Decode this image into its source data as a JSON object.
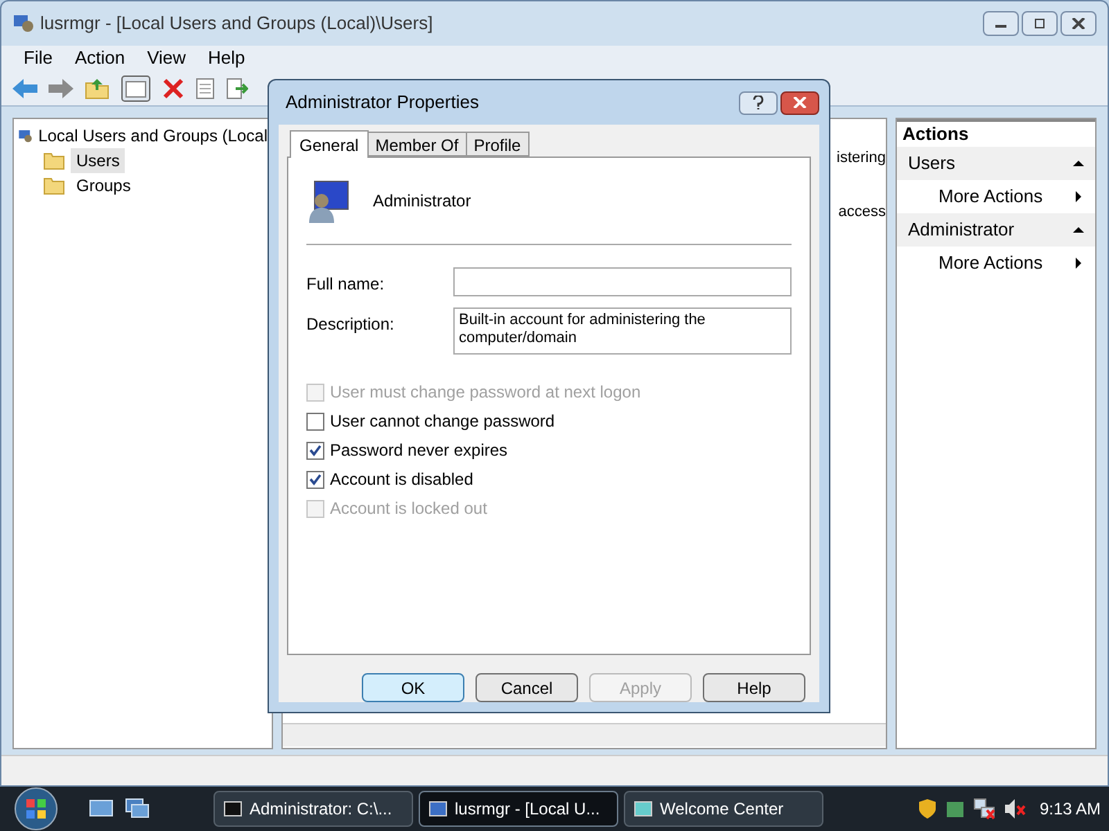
{
  "window": {
    "title": "lusrmgr - [Local Users and Groups (Local)\\Users]"
  },
  "menu": [
    "File",
    "Action",
    "View",
    "Help"
  ],
  "tree": {
    "label": "Local Users and Groups (Local",
    "children": [
      {
        "label": "Users",
        "selected": true
      },
      {
        "label": "Groups",
        "selected": false
      }
    ]
  },
  "middle_pane": {
    "rows": [
      {
        "column_3": "istering"
      },
      {
        "column_3": "access"
      }
    ]
  },
  "actions": {
    "title": "Actions",
    "sections": [
      {
        "title": "Users",
        "expanded": true,
        "items": [
          "More Actions"
        ]
      },
      {
        "title": "Administrator",
        "expanded": true,
        "items": [
          "More Actions"
        ]
      }
    ]
  },
  "dialog": {
    "title": "Administrator Properties",
    "tabs": [
      {
        "label": "General",
        "selected": true
      },
      {
        "label": "Member Of",
        "selected": false
      },
      {
        "label": "Profile",
        "selected": false
      }
    ],
    "user_name": "Administrator",
    "fields": [
      {
        "label": "Full name:"
      },
      {
        "label": "Description:",
        "value": "Built-in account for administering the computer/domain"
      }
    ],
    "options": [
      {
        "label": "User must change password at next logon",
        "checked": false,
        "disabled": true
      },
      {
        "label": "User cannot change password",
        "checked": false,
        "disabled": false
      },
      {
        "label": "Password never expires",
        "checked": true,
        "disabled": false
      },
      {
        "label": "Account is disabled",
        "checked": true,
        "disabled": false
      },
      {
        "label": "Account is locked out",
        "checked": false,
        "disabled": true
      }
    ],
    "buttons": [
      {
        "label": "OK",
        "default": true,
        "disabled": false
      },
      {
        "label": "Cancel",
        "default": false,
        "disabled": false
      },
      {
        "label": "Apply",
        "default": false,
        "disabled": true
      },
      {
        "label": "Help",
        "default": false,
        "disabled": false
      }
    ]
  },
  "taskbar": {
    "tasks": [
      {
        "label": "Administrator: C:\\...",
        "selected": false
      },
      {
        "label": "lusrmgr - [Local U...",
        "selected": true
      },
      {
        "label": "Welcome Center",
        "selected": false
      }
    ],
    "clock": "9:13 AM"
  }
}
